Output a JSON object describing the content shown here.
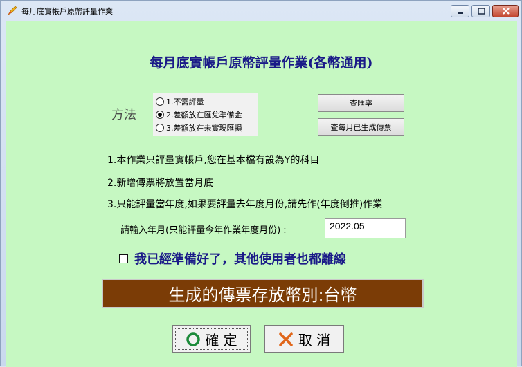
{
  "window": {
    "title": "每月底實帳戶原幣評量作業"
  },
  "heading": "每月底實帳戶原幣評量作業(各幣通用)",
  "method": {
    "label": "方法",
    "options": [
      "1.不需評量",
      "2.差額放在匯兌準備金",
      "3.差額放在未實現匯損"
    ],
    "selected_index": 1
  },
  "buttons": {
    "query_rate": "查匯率",
    "query_vouchers": "查每月已生成傳票",
    "ok": "確 定",
    "cancel": "取 消"
  },
  "notes": [
    "1.本作業只評量實帳戶,您在基本檔有設為Y的科目",
    "2.新增傳票將放置當月底",
    "3.只能評量當年度,如果要評量去年度月份,請先作(年度倒推)作業"
  ],
  "year_month": {
    "label": "請輸入年月(只能評量今年作業年度月份) :",
    "value": "2022.05"
  },
  "ready_checkbox": {
    "label": "我已經準備好了，其他使用者也都離線",
    "checked": false
  },
  "banner": "生成的傳票存放幣別:台幣",
  "colors": {
    "background": "#c6f8c2",
    "heading": "#1a1a88",
    "banner_bg": "#7b3c06",
    "ok_icon": "#1c8a3a",
    "cancel_icon": "#e0661a"
  },
  "icons": {
    "app": "pen-icon",
    "ok": "circle-icon",
    "cancel": "x-icon"
  }
}
